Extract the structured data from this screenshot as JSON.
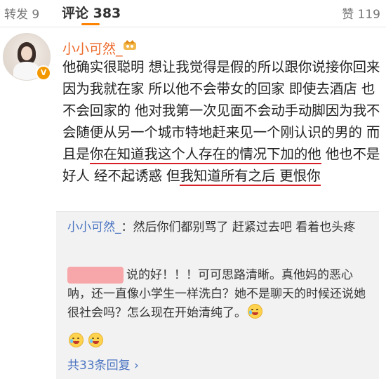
{
  "tabs": {
    "forward_label": "转发 9",
    "comments_label": "评论 383",
    "likes_label": "赞 119"
  },
  "comment": {
    "username": "小小可然_",
    "text_parts": [
      "他确实很聪明 想让我觉得是假的所以跟你说接你回来 因为我就在家 所以他不会带女的回家 即使去酒店 也不会回家的 他对我第一次见面不会动手动脚因为我不会随便从另一个城市特地赶来见一个刚认识的男的 而且是",
      "你在知道我这个人存在的情况下加的他",
      " 他也不是好人 经不起诱惑 但",
      "我知道所有之后 更恨你"
    ]
  },
  "replies": [
    {
      "name": "小小可然_",
      "text": "：然后你们都别骂了 赶紧过去吧 看着也头疼"
    },
    {
      "text": "说的好！！！可可思路清晰。真他妈的恶心呐，还一直像小学生一样洗白？她不是聊天的时候还说她很社会吗？怎么现在开始清纯了。"
    }
  ],
  "more_replies_label": "共33条回复 ›",
  "colors": {
    "accent": "#ff8200",
    "username": "#ec6a2b",
    "link": "#4c75c2",
    "highlight_underline": "#d61f26"
  },
  "icons": [
    "verified-badge-icon",
    "vip-crown-icon",
    "crying-laugh-emoji-icon"
  ]
}
